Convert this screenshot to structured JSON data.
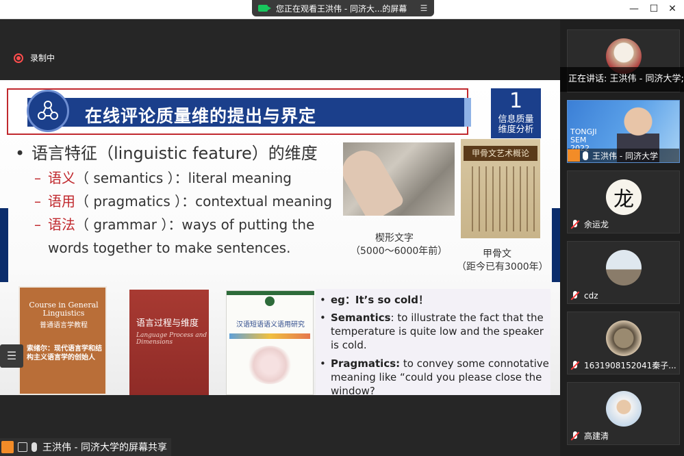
{
  "window": {
    "share_banner": "您正在观看王洪伟 - 同济大...的屏幕",
    "menu_icon": "list-icon",
    "minimize": "—",
    "maximize": "☐",
    "close": "✕"
  },
  "recording": {
    "label": "录制中"
  },
  "slide": {
    "title": "在线评论质量维的提出与界定",
    "badge_number": "1",
    "badge_line1": "信息质量",
    "badge_line2": "维度分析",
    "bullet_main_zh": "语言特征（",
    "bullet_main_en": "linguistic feature",
    "bullet_main_tail": "）的维度",
    "sub_items": [
      {
        "dash": "–",
        "zh": "语义",
        "term": "（ semantics ）：",
        "desc": "literal meaning"
      },
      {
        "dash": "–",
        "zh": "语用",
        "term": "（ pragmatics ）：",
        "desc": "contextual meaning"
      },
      {
        "dash": "–",
        "zh": "语法",
        "term": "（ grammar ）：",
        "desc": "ways of putting the"
      }
    ],
    "continuation": "words together to make sentences.",
    "cuneiform_caption": "楔形文字",
    "cuneiform_years": "（5000～6000年前）",
    "oracle_banner": "甲骨文艺术概论",
    "oracle_caption": "甲骨文",
    "oracle_years": "（距今已有3000年）",
    "book1_title_en": "Course in General Linguistics",
    "book1_title_zh": "普通语言学教程",
    "book1_author": "索绪尔：现代语言学和结构主义语言学的创始人",
    "book2_title": "语言过程与维度",
    "book2_subtitle": "Language Process and Dimensions",
    "book3_title": "汉语短语语义语用研究",
    "example": {
      "eg": "eg：It’s so cold！",
      "sem_label": "Semantics",
      "sem_text1": ": to illustrate the fact that the",
      "sem_text2": "temperature is quite low and the speaker",
      "sem_text3": "is cold.",
      "prag_label": "Pragmatics:",
      "prag_text1": " to convey some connotative",
      "prag_text2": "meaning like “could you please close the",
      "prag_text3": "window?"
    }
  },
  "bottom_bar": {
    "label": "王洪伟 - 同济大学的屏幕共享"
  },
  "gallery": {
    "speaking_label": "正在讲话: 王洪伟 - 同济大学;",
    "active_name": "王洪伟 - 同济大学",
    "brand_lines": [
      "TONGJI",
      "SEM",
      "2022"
    ],
    "participants": [
      {
        "name": "余运龙"
      },
      {
        "name": "cdz"
      },
      {
        "name": "1631908152041秦子..."
      },
      {
        "name": "高建清"
      }
    ],
    "avatar_char": "龙"
  }
}
